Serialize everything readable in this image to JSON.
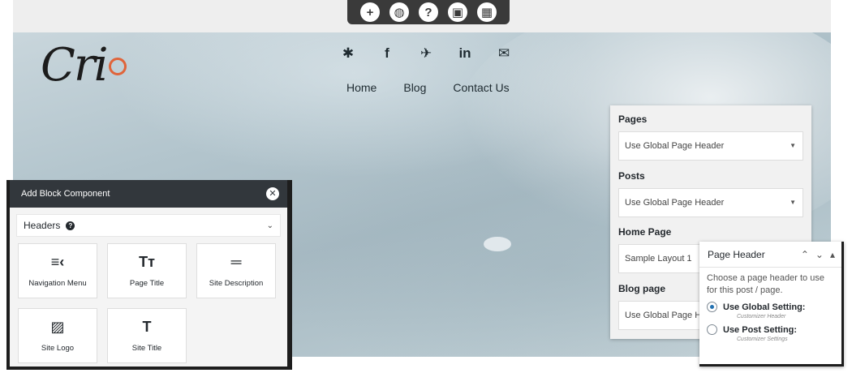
{
  "toolbar": {
    "buttons": [
      {
        "icon": "plus-icon",
        "glyph": "+"
      },
      {
        "icon": "globe-icon",
        "glyph": "◍"
      },
      {
        "icon": "help-icon",
        "glyph": "?"
      },
      {
        "icon": "image-edit-icon",
        "glyph": "▣"
      },
      {
        "icon": "layout-icon",
        "glyph": "▦"
      }
    ]
  },
  "site": {
    "logo_text": "Cri",
    "social": [
      {
        "icon": "yelp-icon",
        "glyph": "✱"
      },
      {
        "icon": "facebook-icon",
        "glyph": "f"
      },
      {
        "icon": "twitter-icon",
        "glyph": "✈"
      },
      {
        "icon": "linkedin-icon",
        "glyph": "in"
      },
      {
        "icon": "envelope-icon",
        "glyph": "✉"
      }
    ],
    "nav": [
      "Home",
      "Blog",
      "Contact Us"
    ]
  },
  "settings": {
    "pages_label": "Pages",
    "pages_value": "Use Global Page Header",
    "posts_label": "Posts",
    "posts_value": "Use Global Page Header",
    "home_label": "Home Page",
    "home_value": "Sample Layout 1",
    "blog_label": "Blog page",
    "blog_value": "Use Global Page He"
  },
  "metabox": {
    "title": "Page Header",
    "description": "Choose a page header to use for this post / page.",
    "option1_label": "Use Global Setting:",
    "option1_sub": "Customizer Header",
    "option2_label": "Use Post Setting:",
    "option2_sub": "Customizer Settings"
  },
  "block_panel": {
    "title": "Add Block Component",
    "section": "Headers",
    "tiles": [
      {
        "label": "Navigation Menu",
        "icon": "navigation-menu-icon",
        "glyph": "≡‹"
      },
      {
        "label": "Page Title",
        "icon": "page-title-icon",
        "glyph": "Tт"
      },
      {
        "label": "Site Description",
        "icon": "site-description-icon",
        "glyph": "═"
      },
      {
        "label": "Site Logo",
        "icon": "site-logo-icon",
        "glyph": "▨"
      },
      {
        "label": "Site Title",
        "icon": "site-title-icon",
        "glyph": "T"
      }
    ]
  }
}
